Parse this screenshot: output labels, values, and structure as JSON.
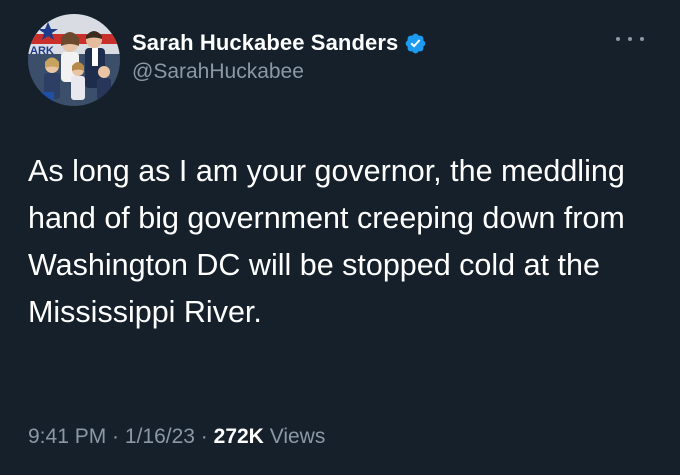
{
  "author": {
    "display_name": "Sarah Huckabee Sanders",
    "handle": "@SarahHuckabee",
    "verified": true,
    "verified_icon": "verified-badge-icon",
    "avatar_icon": "profile-photo",
    "avatar_text": "ARK"
  },
  "menu": {
    "icon": "more-options-icon"
  },
  "tweet": {
    "text": "As long as I am your governor, the meddling hand of big government creeping down from Washington DC will be stopped cold at the Mississippi River."
  },
  "meta": {
    "time": "9:41 PM",
    "separator": " · ",
    "date": "1/16/23",
    "views_count": "272K",
    "views_label": "Views"
  },
  "colors": {
    "background": "#15202b",
    "primary_text": "#ffffff",
    "secondary_text": "#8b98a5",
    "verified_blue": "#1d9bf0"
  }
}
